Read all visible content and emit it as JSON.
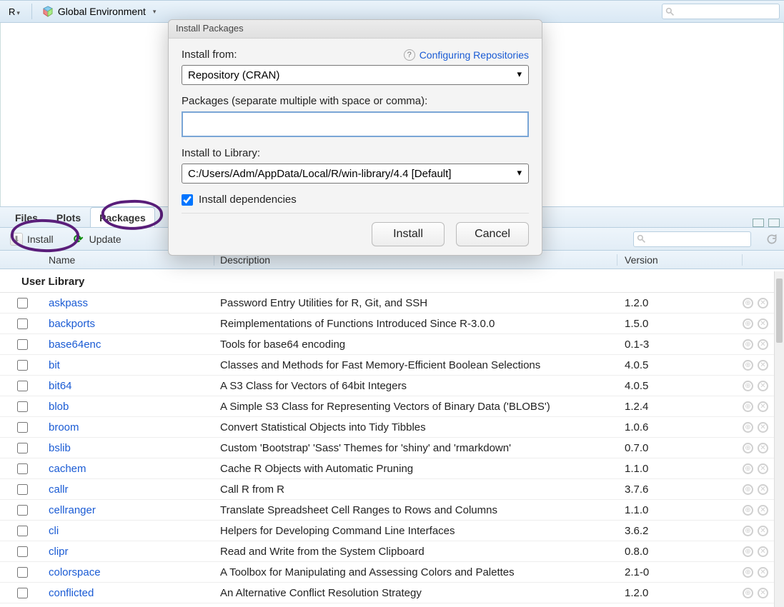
{
  "top": {
    "lang": "R",
    "env": "Global Environment"
  },
  "tabs": {
    "files": "Files",
    "plots": "Plots",
    "packages": "Packages"
  },
  "toolbar": {
    "install": "Install",
    "update": "Update"
  },
  "cols": {
    "name": "Name",
    "desc": "Description",
    "ver": "Version"
  },
  "section": "User Library",
  "packages": [
    {
      "name": "askpass",
      "desc": "Password Entry Utilities for R, Git, and SSH",
      "ver": "1.2.0"
    },
    {
      "name": "backports",
      "desc": "Reimplementations of Functions Introduced Since R-3.0.0",
      "ver": "1.5.0"
    },
    {
      "name": "base64enc",
      "desc": "Tools for base64 encoding",
      "ver": "0.1-3"
    },
    {
      "name": "bit",
      "desc": "Classes and Methods for Fast Memory-Efficient Boolean Selections",
      "ver": "4.0.5"
    },
    {
      "name": "bit64",
      "desc": "A S3 Class for Vectors of 64bit Integers",
      "ver": "4.0.5"
    },
    {
      "name": "blob",
      "desc": "A Simple S3 Class for Representing Vectors of Binary Data ('BLOBS')",
      "ver": "1.2.4"
    },
    {
      "name": "broom",
      "desc": "Convert Statistical Objects into Tidy Tibbles",
      "ver": "1.0.6"
    },
    {
      "name": "bslib",
      "desc": "Custom 'Bootstrap' 'Sass' Themes for 'shiny' and 'rmarkdown'",
      "ver": "0.7.0"
    },
    {
      "name": "cachem",
      "desc": "Cache R Objects with Automatic Pruning",
      "ver": "1.1.0"
    },
    {
      "name": "callr",
      "desc": "Call R from R",
      "ver": "3.7.6"
    },
    {
      "name": "cellranger",
      "desc": "Translate Spreadsheet Cell Ranges to Rows and Columns",
      "ver": "1.1.0"
    },
    {
      "name": "cli",
      "desc": "Helpers for Developing Command Line Interfaces",
      "ver": "3.6.2"
    },
    {
      "name": "clipr",
      "desc": "Read and Write from the System Clipboard",
      "ver": "0.8.0"
    },
    {
      "name": "colorspace",
      "desc": "A Toolbox for Manipulating and Assessing Colors and Palettes",
      "ver": "2.1-0"
    },
    {
      "name": "conflicted",
      "desc": "An Alternative Conflict Resolution Strategy",
      "ver": "1.2.0"
    }
  ],
  "dialog": {
    "title": "Install Packages",
    "install_from_label": "Install from:",
    "config_link": "Configuring Repositories",
    "install_from_value": "Repository (CRAN)",
    "packages_label": "Packages (separate multiple with space or comma):",
    "packages_value": "",
    "lib_label": "Install to Library:",
    "lib_value": "C:/Users/Adm/AppData/Local/R/win-library/4.4 [Default]",
    "deps_label": "Install dependencies",
    "btn_install": "Install",
    "btn_cancel": "Cancel"
  }
}
